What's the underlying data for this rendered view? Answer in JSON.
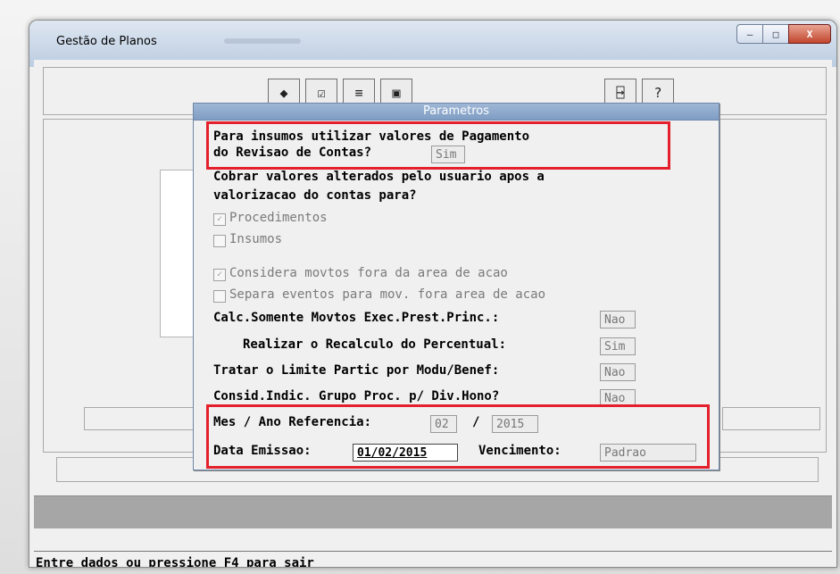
{
  "window": {
    "title": "Gestão de Planos",
    "buttons": {
      "minimize": "—",
      "maximize": "□",
      "close": "X"
    }
  },
  "toolbar": {
    "icons": [
      "diamond-edit-icon",
      "checklist-icon",
      "list-icon",
      "print-icon",
      "exit-door-icon",
      "help-icon"
    ],
    "glyphs": [
      "◆",
      "☑",
      "≡",
      "▣",
      "⍈",
      "?"
    ]
  },
  "dialog": {
    "title": "Parametros",
    "q1_line1": "Para insumos utilizar valores de Pagamento",
    "q1_line2": "do Revisao de Contas?",
    "q1_value": "Sim",
    "q2_line1": "Cobrar valores alterados pelo usuario apos a",
    "q2_line2": "valorizacao do contas para?",
    "chk_procedimentos": "Procedimentos",
    "chk_procedimentos_checked": "✓",
    "chk_insumos": "Insumos",
    "chk_considera": "Considera movtos fora da area de acao",
    "chk_considera_checked": "✓",
    "chk_separa": "Separa eventos para mov. fora area de acao",
    "calc_label": "Calc.Somente Movtos Exec.Prest.Princ.:",
    "calc_value": "Nao",
    "realizar_label": "Realizar o Recalculo do Percentual:",
    "realizar_value": "Sim",
    "tratar_label": "Tratar o Limite Partic por Modu/Benef:",
    "tratar_value": "Nao",
    "consid_label": "Consid.Indic. Grupo Proc. p/ Div.Hono?",
    "consid_value": "Nao",
    "mes_label": "Mes / Ano Referencia:",
    "mes_value": "02",
    "slash": "/",
    "ano_value": "2015",
    "data_label": "Data Emissao:",
    "data_value": "01/02/2015",
    "venc_label": "Vencimento:",
    "venc_value": "Padrao"
  },
  "status": {
    "text": "Entre dados ou pressione F4 para sair"
  },
  "highlight_color": "#e3202b"
}
